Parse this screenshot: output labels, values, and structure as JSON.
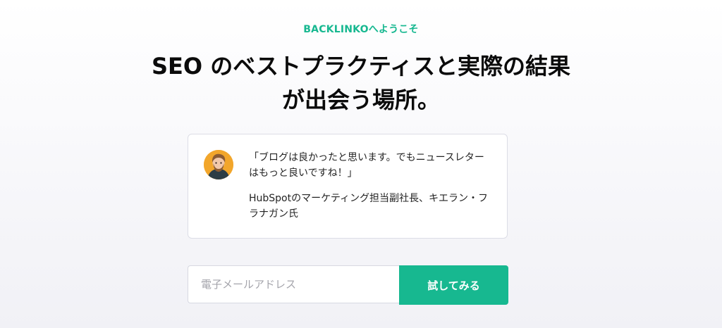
{
  "hero": {
    "eyebrow": "BACKLINKOへようこそ",
    "headline": "SEO のベストプラクティスと実際の結果が出会う場所。"
  },
  "testimonial": {
    "quote": "「ブログは良かったと思います。でもニュースレターはもっと良いですね！」",
    "attribution": "HubSpotのマーケティング担当副社長、キエラン・フラナガン氏",
    "avatar_icon": "person-avatar-icon"
  },
  "signup": {
    "email_placeholder": "電子メールアドレス",
    "button_label": "試してみる"
  },
  "colors": {
    "accent": "#17b890",
    "card_border": "#dcdde6",
    "heading": "#0b0b0b",
    "body_text": "#232323",
    "placeholder": "#a4a4ab"
  }
}
